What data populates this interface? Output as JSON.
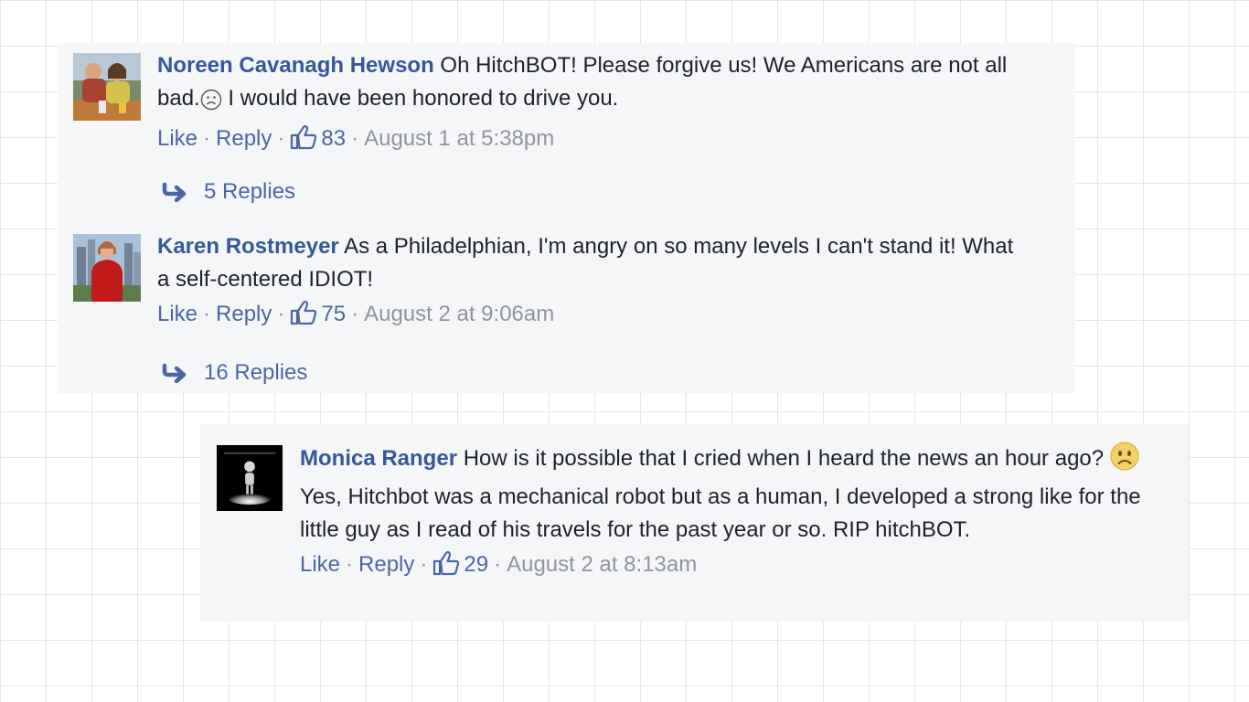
{
  "comments": [
    {
      "author": "Noreen Cavanagh Hewson",
      "text_before_emoji": " Oh HitchBOT! Please forgive us! We Americans are not all bad.",
      "emoji": "frown-emoji-outline",
      "text_after_emoji": " I would have been honored to drive you.",
      "like_label": "Like",
      "reply_label": "Reply",
      "likes": "83",
      "timestamp": "August 1 at 5:38pm",
      "replies_label": "5 Replies",
      "avatar": "two-people-photo"
    },
    {
      "author": "Karen Rostmeyer",
      "text": " As a Philadelphian, I'm angry on so many levels I can't stand it! What a self-centered IDIOT!",
      "like_label": "Like",
      "reply_label": "Reply",
      "likes": "75",
      "timestamp": "August 2 at 9:06am",
      "replies_label": "16 Replies",
      "avatar": "woman-city-photo"
    },
    {
      "author": "Monica Ranger",
      "text_before_emoji": " How is it possible that I cried when I heard the news an hour ago? ",
      "emoji": "frown-emoji-yellow",
      "text_after_emoji": " Yes, Hitchbot was a mechanical robot but as a human, I developed a strong like for the little guy as I read of his travels for the past year or so. RIP hitchBOT.",
      "like_label": "Like",
      "reply_label": "Reply",
      "likes": "29",
      "timestamp": "August 2 at 8:13am",
      "avatar": "robot-spotlight-photo"
    }
  ],
  "colors": {
    "author": "#365899",
    "link": "#4b67a1",
    "meta": "#90949c",
    "panel": "#f5f6f8"
  }
}
